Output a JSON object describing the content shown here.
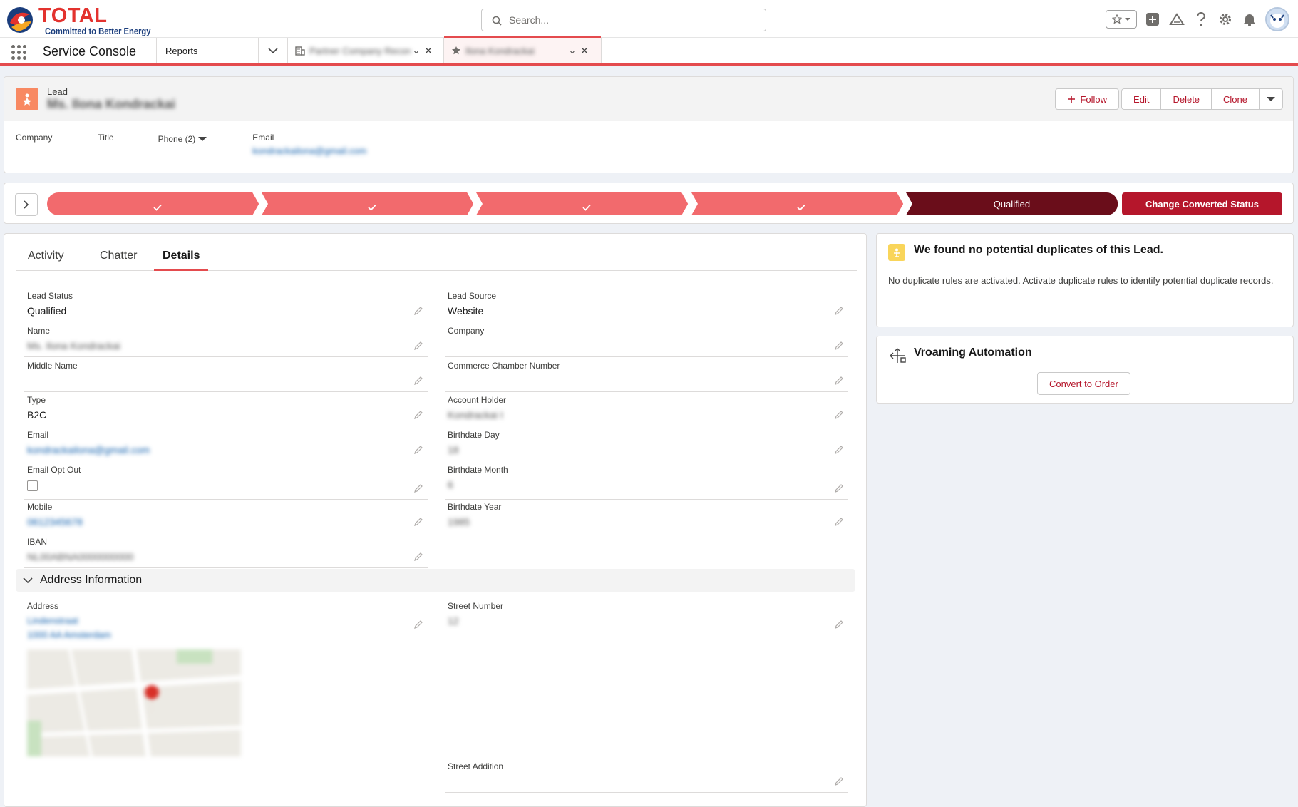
{
  "brand": {
    "name": "TOTAL",
    "tagline": "Committed to Better Energy",
    "primary_color": "#e3322e",
    "accent_color": "#b5162b"
  },
  "search": {
    "placeholder": "Search..."
  },
  "header_icons": [
    "favorites-star-icon",
    "add-icon",
    "trailhead-icon",
    "help-icon",
    "setup-gear-icon",
    "notifications-bell-icon",
    "user-avatar"
  ],
  "nav": {
    "app_name": "Service Console",
    "item": "Reports",
    "tabs": [
      {
        "label": "Partner Company Record",
        "icon": "building-icon",
        "active": false
      },
      {
        "label": "Ilona Kondrackai",
        "icon": "lead-star-icon",
        "active": true
      }
    ]
  },
  "record": {
    "object": "Lead",
    "name": "Ms. Ilona Kondrackai",
    "actions": {
      "follow": "Follow",
      "edit": "Edit",
      "delete": "Delete",
      "clone": "Clone"
    },
    "highlights": {
      "company_label": "Company",
      "title_label": "Title",
      "phone_label": "Phone (2)",
      "email_label": "Email",
      "email_value": "kondrackailona@gmail.com"
    }
  },
  "path": {
    "stages": [
      "",
      "",
      "",
      "",
      "Qualified"
    ],
    "completed_count": 4,
    "current": "Qualified",
    "button": "Change Converted Status"
  },
  "tabs": {
    "activity": "Activity",
    "chatter": "Chatter",
    "details": "Details"
  },
  "details": {
    "lead_status": {
      "label": "Lead Status",
      "value": "Qualified"
    },
    "lead_source": {
      "label": "Lead Source",
      "value": "Website"
    },
    "name": {
      "label": "Name",
      "value": "Ms. Ilona Kondrackai"
    },
    "company": {
      "label": "Company",
      "value": ""
    },
    "middle_name": {
      "label": "Middle Name",
      "value": ""
    },
    "commerce_chamber": {
      "label": "Commerce Chamber Number",
      "value": ""
    },
    "type": {
      "label": "Type",
      "value": "B2C"
    },
    "account_holder": {
      "label": "Account Holder",
      "value": "Kondrackai I"
    },
    "email": {
      "label": "Email",
      "value": "kondrackailona@gmail.com"
    },
    "birth_day": {
      "label": "Birthdate Day",
      "value": "18"
    },
    "email_opt_out": {
      "label": "Email Opt Out",
      "checked": false
    },
    "birth_month": {
      "label": "Birthdate Month",
      "value": "6"
    },
    "mobile": {
      "label": "Mobile",
      "value": "0612345678"
    },
    "birth_year": {
      "label": "Birthdate Year",
      "value": "1985"
    },
    "iban": {
      "label": "IBAN",
      "value": "NL00ABNA0000000000"
    }
  },
  "address_section": {
    "title": "Address Information",
    "address": {
      "label": "Address",
      "line1": "Lindenstraat",
      "line2": "1000 AA Amsterdam"
    },
    "street_number": {
      "label": "Street Number",
      "value": "12"
    },
    "street_addition": {
      "label": "Street Addition",
      "value": ""
    }
  },
  "duplicates_card": {
    "title": "We found no potential duplicates of this Lead.",
    "text": "No duplicate rules are activated. Activate duplicate rules to identify potential duplicate records."
  },
  "automation_card": {
    "title": "Vroaming Automation",
    "button": "Convert to Order"
  }
}
